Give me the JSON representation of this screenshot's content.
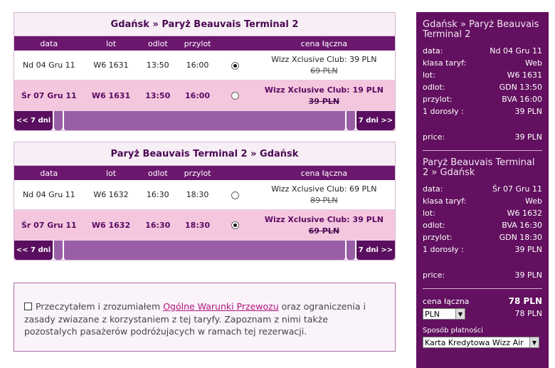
{
  "outbound": {
    "title": "Gdańsk » Paryż Beauvais Terminal 2",
    "cols": {
      "data": "data",
      "lot": "lot",
      "odlot": "odlot",
      "przylot": "przylot",
      "cena": "cena łączna"
    },
    "rows": [
      {
        "date": "Nd 04 Gru 11",
        "flight": "W6 1631",
        "dep": "13:50",
        "arr": "16:00",
        "price": "Wizz Xclusive Club: 39 PLN",
        "old": "69 PLN",
        "selected": true
      },
      {
        "date": "Śr 07 Gru 11",
        "flight": "W6 1631",
        "dep": "13:50",
        "arr": "16:00",
        "price": "Wizz Xclusive Club: 19 PLN",
        "old": "39 PLN",
        "selected": false
      }
    ],
    "prev": "<< 7 dni",
    "next": "7 dni >>"
  },
  "return": {
    "title": "Paryż Beauvais Terminal 2 » Gdańsk",
    "cols": {
      "data": "data",
      "lot": "lot",
      "odlot": "odlot",
      "przylot": "przylot",
      "cena": "cena łączna"
    },
    "rows": [
      {
        "date": "Nd 04 Gru 11",
        "flight": "W6 1632",
        "dep": "16:30",
        "arr": "18:30",
        "price": "Wizz Xclusive Club: 69 PLN",
        "old": "89 PLN",
        "selected": false
      },
      {
        "date": "Śr 07 Gru 11",
        "flight": "W6 1632",
        "dep": "16:30",
        "arr": "18:30",
        "price": "Wizz Xclusive Club: 39 PLN",
        "old": "69 PLN",
        "selected": true
      }
    ],
    "prev": "<< 7 dni",
    "next": "7 dni >>"
  },
  "terms": {
    "before": "Przeczytałem i zrozumiałem ",
    "link": "Ogólne Warunki Przewozu",
    "after": " oraz ograniczenia i zasady zwiazane z korzystaniem z tej taryfy. Zapoznam z nimi także pozostalych pasażerów podróżujacych w ramach tej rezerwacji."
  },
  "sidebar": {
    "leg1": {
      "route": "Gdańsk » Paryż Beauvais Terminal 2",
      "lines": [
        {
          "label": "data:",
          "value": "Nd 04 Gru 11"
        },
        {
          "label": "klasa taryf:",
          "value": "Web"
        },
        {
          "label": "lot:",
          "value": "W6 1631"
        },
        {
          "label": "odlot:",
          "value": "GDN 13:50"
        },
        {
          "label": "przylot:",
          "value": "BVA 16:00"
        },
        {
          "label": "1 dorosły :",
          "value": "39 PLN"
        }
      ],
      "price_label": "price:",
      "price_value": "39 PLN"
    },
    "leg2": {
      "route": "Paryż Beauvais Terminal 2 » Gdańsk",
      "lines": [
        {
          "label": "data:",
          "value": "Śr 07 Gru 11"
        },
        {
          "label": "klasa taryf:",
          "value": "Web"
        },
        {
          "label": "lot:",
          "value": "W6 1632"
        },
        {
          "label": "odlot:",
          "value": "BVA 16:30"
        },
        {
          "label": "przylot:",
          "value": "GDN 18:30"
        },
        {
          "label": "1 dorosły :",
          "value": "39 PLN"
        }
      ],
      "price_label": "price:",
      "price_value": "39 PLN"
    },
    "total_label": "cena łączna",
    "total_value": "78 PLN",
    "currency": "PLN",
    "currency_total": "78 PLN",
    "payment_label": "Sposób płatności",
    "payment_value": "Karta Kredytowa Wizz Air"
  }
}
